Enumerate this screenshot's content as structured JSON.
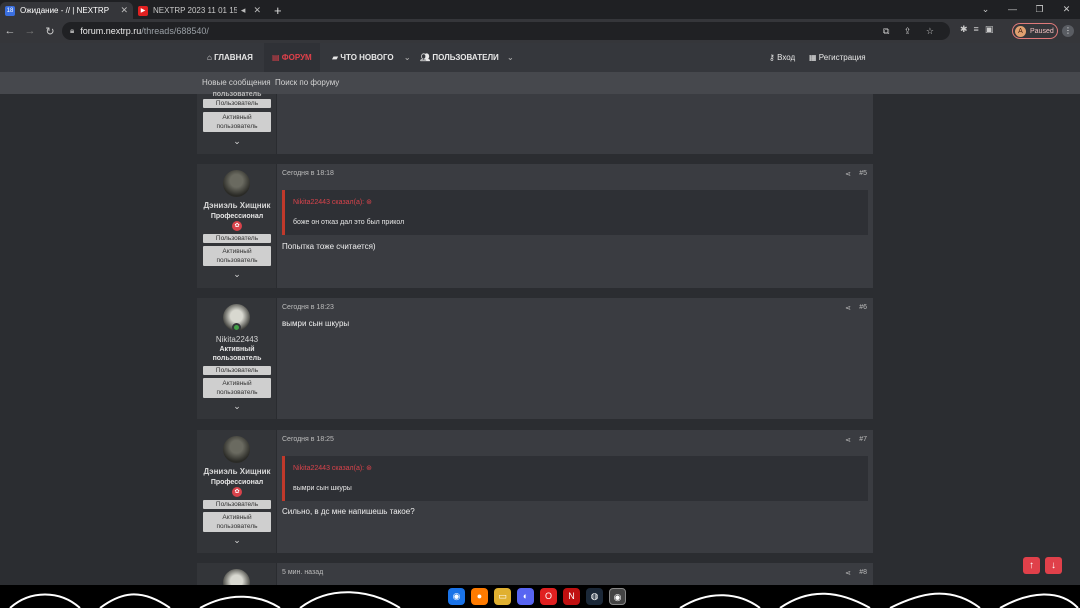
{
  "browser": {
    "tabs": [
      {
        "title": "Ожидание - // | NEXTRP",
        "favicon_color": "#3a6fe0",
        "favicon_text": "18"
      },
      {
        "title": "NEXTRP 2023 11 01 15 18 2",
        "favicon_color": "#e02020",
        "favicon_text": "▶"
      }
    ],
    "new_tab": "+",
    "url_host": "forum.nextrp.ru",
    "url_path": "/threads/688540/",
    "profile_label": "Paused",
    "profile_initial": "A"
  },
  "forum": {
    "nav": {
      "home": "ГЛАВНАЯ",
      "forums": "ФОРУМ",
      "whats_new": "ЧТО НОВОГО",
      "members": "ПОЛЬЗОВАТЕЛИ",
      "login": "Вход",
      "register": "Регистрация"
    },
    "subnav": {
      "new_messages": "Новые сообщения",
      "search": "Поиск по форуму"
    }
  },
  "top_partial": {
    "cut_label": "пользователь",
    "group1": "Пользователь",
    "group2_line1": "Активный",
    "group2_line2": "пользователь"
  },
  "posts": [
    {
      "author": "Дэниэль Хищник",
      "title": "Профессионал",
      "groups": [
        "Пользователь",
        "Активный",
        "пользователь"
      ],
      "date": "Сегодня в 18:18",
      "number": "#5",
      "quote_author": "Nikita22443 сказал(а):",
      "quote_text": "боже он отказ дал это был прикол",
      "message": "Попытка тоже считается)"
    },
    {
      "author": "Nikita22443",
      "title_line1": "Активный",
      "title_line2": "пользователь",
      "groups": [
        "Пользователь",
        "Активный",
        "пользователь"
      ],
      "date": "Сегодня в 18:23",
      "number": "#6",
      "message": "вымри сын шкуры"
    },
    {
      "author": "Дэниэль Хищник",
      "title": "Профессионал",
      "groups": [
        "Пользователь",
        "Активный",
        "пользователь"
      ],
      "date": "Сегодня в 18:25",
      "number": "#7",
      "quote_author": "Nikita22443 сказал(а):",
      "quote_text": "вымри сын шкуры",
      "message": "Сильно, в дс мне напишешь такое?"
    },
    {
      "date": "5 мин. назад",
      "number": "#8"
    }
  ],
  "colors": {
    "accent": "#e0404a",
    "background": "#2b2d31",
    "post_bg": "#3a3c41"
  }
}
